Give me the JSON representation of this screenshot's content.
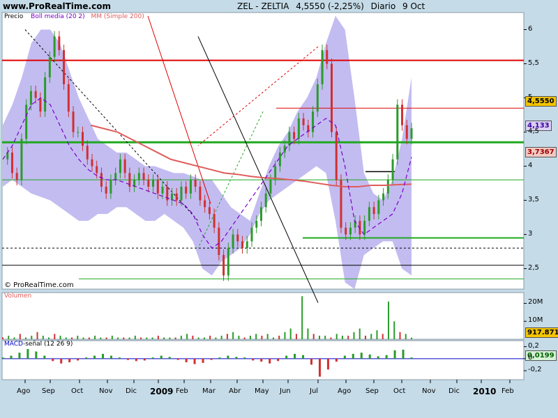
{
  "header": {
    "site": "www.ProRealTime.com",
    "symbol": "ZEL - ZELTIA",
    "price_change": "4,5550 (-2,25%)",
    "period": "Diario",
    "date": "9 Oct"
  },
  "copyright": "© ProRealTime.com",
  "colors": {
    "background": "#c5dbe8",
    "plot_bg": "#ffffff",
    "bollinger_fill": "#b8b0ee",
    "bollinger_mid": "#7a00c8",
    "ma200": "#e05c5c",
    "resistance_red": "#e00000",
    "support_green": "#1fa81f",
    "candle_up": "#2a9b2a",
    "candle_down": "#d03030",
    "macd_line": "#0000c8"
  },
  "chart_data": [
    {
      "type": "line",
      "panel": "Precio",
      "legend": [
        "Precio",
        "Boll media (20 2)",
        "MM (Simple 200)"
      ],
      "x_tick_labels": [
        "Ago",
        "Sep",
        "Oct",
        "Nov",
        "Dic",
        "2009",
        "Feb",
        "Mar",
        "Abr",
        "May",
        "Jun",
        "Jul",
        "Ago",
        "Sep",
        "Oct",
        "Nov",
        "Dic",
        "2010",
        "Feb"
      ],
      "y_ticks": [
        "6",
        "5,5",
        "5",
        "4,5",
        "4",
        "3,5",
        "3",
        "2,5"
      ],
      "ylim": [
        2.2,
        6.25
      ],
      "last_values": {
        "price": "4,5550",
        "bollinger_mid": "4,133",
        "ma200": "3,7367"
      },
      "price_close": [
        4.1,
        4.2,
        3.9,
        3.8,
        4.4,
        4.9,
        5.1,
        5.0,
        4.8,
        5.3,
        5.6,
        5.9,
        5.7,
        5.2,
        4.8,
        4.5,
        4.5,
        4.3,
        4.1,
        4.0,
        3.9,
        3.7,
        3.6,
        3.8,
        3.9,
        4.1,
        3.9,
        3.7,
        3.8,
        3.9,
        3.8,
        3.7,
        3.8,
        3.6,
        3.7,
        3.5,
        3.6,
        3.5,
        3.7,
        3.6,
        3.8,
        3.7,
        3.5,
        3.4,
        3.3,
        3.1,
        2.7,
        2.4,
        2.8,
        3.0,
        2.9,
        2.8,
        2.9,
        3.1,
        3.2,
        3.4,
        3.6,
        3.8,
        4.0,
        4.2,
        4.3,
        4.5,
        4.4,
        4.7,
        4.6,
        4.5,
        4.8,
        5.2,
        5.7,
        5.5,
        4.5,
        3.8,
        3.1,
        3.0,
        3.1,
        3.2,
        3.0,
        3.2,
        3.4,
        3.3,
        3.5,
        3.6,
        3.8,
        4.1,
        4.9,
        4.6,
        4.4,
        4.555
      ],
      "bollinger_upper": [
        4.6,
        4.9,
        5.3,
        5.8,
        6.0,
        6.0,
        5.8,
        5.4,
        5.0,
        4.7,
        4.4,
        4.3,
        4.2,
        4.2,
        4.1,
        4.0,
        4.0,
        3.95,
        3.9,
        3.9,
        3.85,
        3.8,
        3.8,
        3.6,
        3.4,
        3.3,
        3.2,
        3.6,
        4.0,
        4.3,
        4.5,
        4.8,
        5.0,
        5.3,
        5.8,
        6.2,
        6.0,
        5.0,
        3.9,
        3.6,
        3.5,
        3.8,
        4.4,
        5.3
      ],
      "bollinger_lower": [
        3.7,
        3.8,
        3.7,
        3.6,
        3.55,
        3.5,
        3.4,
        3.3,
        3.2,
        3.2,
        3.3,
        3.3,
        3.4,
        3.4,
        3.3,
        3.2,
        3.2,
        3.3,
        3.2,
        3.1,
        2.9,
        2.5,
        2.4,
        2.6,
        2.7,
        2.8,
        3.0,
        3.3,
        3.5,
        3.6,
        3.7,
        3.8,
        3.9,
        4.0,
        3.9,
        3.2,
        2.3,
        2.2,
        2.7,
        2.8,
        2.9,
        2.9,
        2.5,
        2.4
      ],
      "bollinger_mid": [
        4.1,
        4.3,
        4.6,
        4.9,
        5.0,
        4.9,
        4.6,
        4.3,
        4.1,
        3.95,
        3.85,
        3.8,
        3.8,
        3.75,
        3.7,
        3.65,
        3.6,
        3.55,
        3.5,
        3.45,
        3.3,
        3.0,
        2.8,
        2.9,
        3.1,
        3.3,
        3.5,
        3.7,
        3.9,
        4.1,
        4.3,
        4.4,
        4.5,
        4.6,
        4.7,
        4.6,
        4.0,
        3.2,
        3.0,
        3.1,
        3.2,
        3.3,
        3.6,
        4.133
      ],
      "ma200": [
        4.6,
        4.55,
        4.5,
        4.4,
        4.3,
        4.2,
        4.1,
        4.05,
        4.0,
        3.95,
        3.9,
        3.88,
        3.85,
        3.83,
        3.82,
        3.8,
        3.78,
        3.75,
        3.72,
        3.7,
        3.7,
        3.72,
        3.72,
        3.73,
        3.7367
      ],
      "horizontal_levels": {
        "red": [
          5.55,
          4.85
        ],
        "green": [
          4.35,
          3.8,
          2.95
        ],
        "black": [
          2.8,
          2.55
        ],
        "short_black": [
          3.92
        ]
      },
      "trendlines": [
        {
          "color": "red",
          "from": [
            "Mar",
            3.45
          ],
          "to": [
            "Dic",
            6.2
          ],
          "style": "solid"
        },
        {
          "color": "black",
          "from": [
            "Jul",
            2.0
          ],
          "to": [
            "Feb",
            5.9
          ],
          "style": "solid"
        },
        {
          "color": "black",
          "from": [
            "Ago",
            6.0
          ],
          "to": [
            "Feb",
            3.2
          ],
          "style": "dashed"
        },
        {
          "color": "green",
          "from": [
            "May",
            4.8
          ],
          "to": [
            "Feb",
            2.8
          ],
          "style": "dashed"
        },
        {
          "color": "red",
          "from": [
            "Jul",
            5.75
          ],
          "to": [
            "Feb",
            4.3
          ],
          "style": "dashed"
        }
      ]
    },
    {
      "type": "bar",
      "panel": "Volumen",
      "legend": [
        "Volumen"
      ],
      "y_ticks": [
        "20M",
        "10M"
      ],
      "ylim": [
        0,
        26
      ],
      "last_value": "917.871",
      "values": [
        1,
        2,
        1,
        3,
        1,
        2,
        4,
        2,
        1,
        3,
        2,
        1,
        1,
        2,
        1,
        1,
        2,
        1,
        1,
        2,
        1,
        1,
        1,
        2,
        1,
        1,
        1,
        2,
        1,
        1,
        1,
        2,
        3,
        2,
        1,
        1,
        2,
        1,
        2,
        3,
        4,
        2,
        1,
        2,
        3,
        2,
        3,
        1,
        2,
        4,
        6,
        3,
        24,
        6,
        3,
        2,
        2,
        1,
        3,
        2,
        2,
        4,
        6,
        2,
        3,
        5,
        3,
        21,
        10,
        4,
        3,
        0.9
      ]
    },
    {
      "type": "bar",
      "panel": "MACD",
      "legend": [
        "MACD",
        "señal (12 26 9)"
      ],
      "y_ticks": [
        "0,2",
        "0",
        "-0,2"
      ],
      "ylim": [
        -0.35,
        0.3
      ],
      "last_value": "0,0199",
      "histogram": [
        0.02,
        0.05,
        0.1,
        0.16,
        0.12,
        0.05,
        -0.04,
        -0.08,
        -0.06,
        -0.03,
        0.02,
        0.05,
        0.08,
        0.05,
        0.02,
        -0.02,
        -0.04,
        -0.03,
        0.02,
        0.05,
        0.03,
        -0.02,
        -0.06,
        -0.09,
        -0.07,
        -0.02,
        0.02,
        0.05,
        0.03,
        0.02,
        -0.03,
        -0.05,
        -0.08,
        -0.04,
        0.05,
        0.08,
        0.06,
        -0.1,
        -0.3,
        -0.18,
        -0.05,
        0.05,
        0.08,
        0.1,
        0.07,
        0.04,
        0.06,
        0.14,
        0.15,
        0.0199
      ]
    }
  ]
}
